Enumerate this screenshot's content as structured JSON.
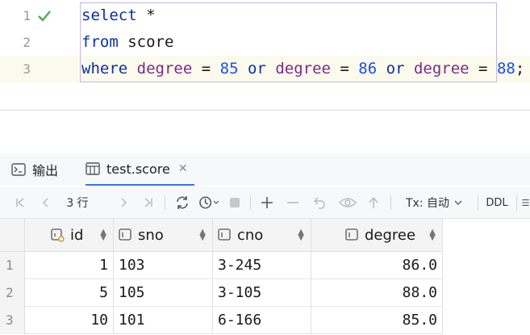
{
  "editor": {
    "lines": [
      {
        "num": "1",
        "kw": "select",
        "rest": " *"
      },
      {
        "num": "2",
        "kw": "from",
        "rest": " score"
      },
      {
        "num": "3",
        "kw": "where",
        "rest": ""
      }
    ],
    "line3": {
      "c1": "degree",
      "op1": " = ",
      "n1": "85",
      "or1": "or",
      "c2": "degree",
      "op2": " = ",
      "n2": "86",
      "or2": "or",
      "c3": "degree",
      "op3": " = ",
      "n3": "88",
      "end": ";"
    },
    "check_color": "#4caf50"
  },
  "tabs": [
    {
      "label": "输出",
      "icon": "console-icon"
    },
    {
      "label": "test.score",
      "icon": "table-icon",
      "active": true
    }
  ],
  "toolbar": {
    "rows_count": "3 行",
    "tx_label": "Tx: 自动",
    "ddl_label": "DDL"
  },
  "grid": {
    "columns": [
      {
        "label": "id",
        "icon": "key-column-icon"
      },
      {
        "label": "sno",
        "icon": "column-icon"
      },
      {
        "label": "cno",
        "icon": "column-icon"
      },
      {
        "label": "degree",
        "icon": "column-icon"
      }
    ],
    "rows": [
      {
        "n": "1",
        "id": "1",
        "sno": "103",
        "cno": "3-245",
        "degree": "86.0"
      },
      {
        "n": "2",
        "id": "5",
        "sno": "105",
        "cno": "3-105",
        "degree": "88.0"
      },
      {
        "n": "3",
        "id": "10",
        "sno": "101",
        "cno": "6-166",
        "degree": "85.0"
      }
    ]
  }
}
